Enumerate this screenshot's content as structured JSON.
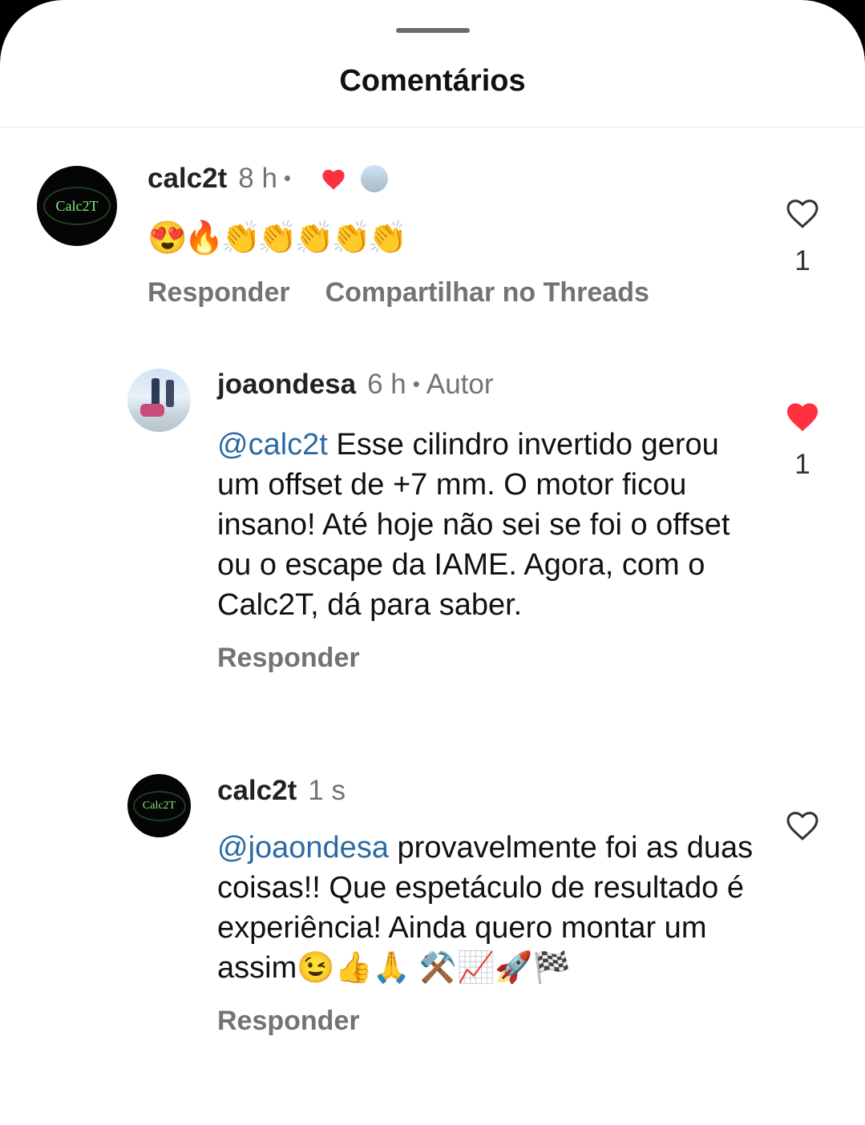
{
  "header": {
    "title": "Comentários"
  },
  "comments": [
    {
      "avatar_text": "Calc2T",
      "username": "calc2t",
      "time": "8 h",
      "body": "😍🔥👏👏👏👏👏",
      "actions": {
        "reply": "Responder",
        "share": "Compartilhar no Threads"
      },
      "likes": "1",
      "liked": false
    },
    {
      "username": "joaondesa",
      "time": "6 h",
      "tag": "Autor",
      "mention": "@calc2t",
      "body": " Esse cilindro invertido gerou um offset de +7 mm. O motor ficou insano! Até hoje não sei se foi o offset ou o escape da IAME. Agora, com o Calc2T, dá para saber.",
      "actions": {
        "reply": "Responder"
      },
      "likes": "1",
      "liked": true
    },
    {
      "avatar_text": "Calc2T",
      "username": "calc2t",
      "time": "1 s",
      "mention": "@joaondesa",
      "body": " provavelmente foi as duas coisas!! Que espetáculo de resultado é experiência! Ainda quero montar um assim😉👍🙏 ⚒️📈🚀🏁",
      "actions": {
        "reply": "Responder"
      },
      "liked": false
    }
  ],
  "colors": {
    "like_active": "#ff3040",
    "mention": "#2b6aa3",
    "muted": "#737373"
  }
}
